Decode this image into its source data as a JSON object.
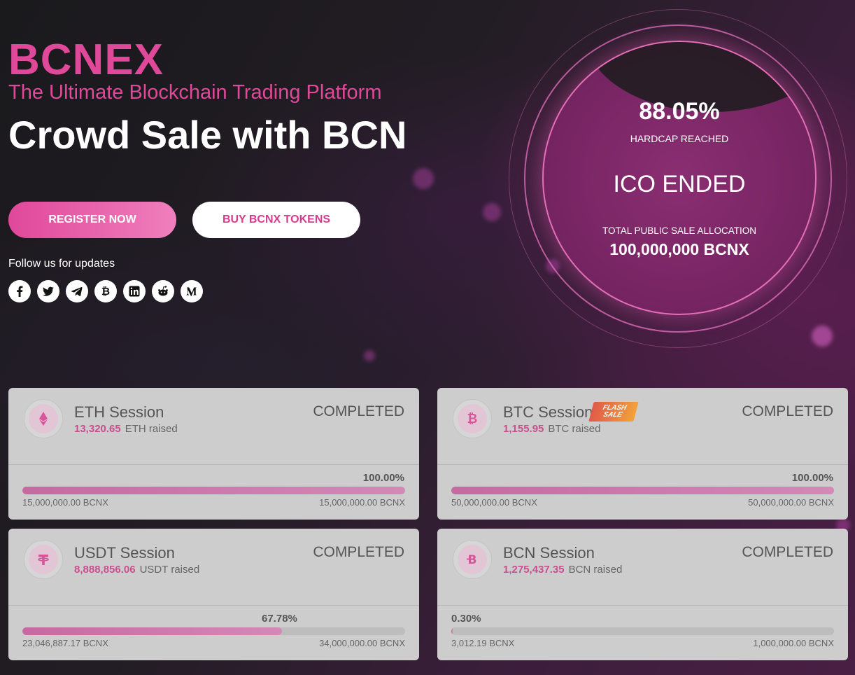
{
  "hero": {
    "brand": "BCNEX",
    "tagline": "The Ultimate Blockchain Trading Platform",
    "headline": "Crowd Sale with BCN",
    "register_label": "REGISTER NOW",
    "buy_label": "BUY BCNX TOKENS",
    "follow_label": "Follow us for updates",
    "socials": [
      "facebook-icon",
      "twitter-icon",
      "telegram-icon",
      "bitcoin-icon",
      "linkedin-icon",
      "reddit-icon",
      "medium-icon"
    ]
  },
  "progress_circle": {
    "percent": "88.05%",
    "percent_label": "HARDCAP REACHED",
    "status": "ICO ENDED",
    "allocation_label": "TOTAL PUBLIC SALE ALLOCATION",
    "allocation_value": "100,000,000 BCNX"
  },
  "sessions": [
    {
      "name": "ETH Session",
      "raised_amount": "13,320.65",
      "raised_label": "ETH raised",
      "status": "COMPLETED",
      "percent": "100.00%",
      "fill": 1.0,
      "min": "15,000,000.00 BCNX",
      "max": "15,000,000.00 BCNX",
      "icon": "ethereum-icon"
    },
    {
      "name": "BTC Session",
      "raised_amount": "1,155.95",
      "raised_label": "BTC raised",
      "status": "COMPLETED",
      "percent": "100.00%",
      "fill": 1.0,
      "min": "50,000,000.00 BCNX",
      "max": "50,000,000.00 BCNX",
      "icon": "bitcoin-icon",
      "badge_line1": "FLASH",
      "badge_line2": "SALE"
    },
    {
      "name": "USDT Session",
      "raised_amount": "8,888,856.06",
      "raised_label": "USDT raised",
      "status": "COMPLETED",
      "percent": "67.78%",
      "fill": 0.6778,
      "min": "23,046,887.17 BCNX",
      "max": "34,000,000.00 BCNX",
      "icon": "tether-icon"
    },
    {
      "name": "BCN Session",
      "raised_amount": "1,275,437.35",
      "raised_label": "BCN raised",
      "status": "COMPLETED",
      "percent": "0.30%",
      "fill": 0.003,
      "min": "3,012.19 BCNX",
      "max": "1,000,000.00 BCNX",
      "icon": "bytecoin-icon"
    }
  ],
  "colors": {
    "brand_pink": "#e0489a",
    "amount_pink": "#c8508e",
    "card_bg": "#cdcdcd"
  }
}
